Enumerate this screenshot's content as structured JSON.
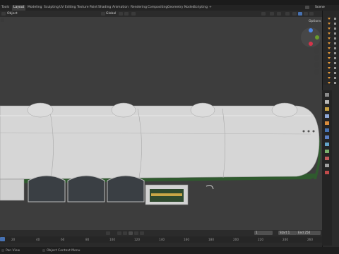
{
  "workspace_tabs": [
    "Tools",
    "Layout",
    "Modeling",
    "Sculpting",
    "UV Editing",
    "Texture Paint",
    "Shading",
    "Animation",
    "Rendering",
    "Compositing",
    "Geometry Nodes",
    "Scripting",
    "+"
  ],
  "active_tab": "Layout",
  "scene_label": "Scene",
  "viewport_header": {
    "mode": "Object",
    "orientation": "Global",
    "options_label": "Options"
  },
  "timeline": {
    "current_frame": "1",
    "start_label": "Start",
    "start_value": "1",
    "end_label": "End",
    "end_value": "250",
    "ruler": [
      "20",
      "40",
      "60",
      "80",
      "100",
      "120",
      "140",
      "160",
      "180",
      "200",
      "220",
      "240",
      "260"
    ]
  },
  "status_bar": {
    "left": "Pan View",
    "right": "Object Context Menu"
  },
  "colors": {
    "accent": "#4772b3",
    "background_viewport": "#3d3d3d",
    "model_body": "#d7d7d7",
    "model_trim": "#2f5a2e"
  },
  "icons": [
    "select-icon",
    "cursor-icon",
    "move-icon",
    "rotate-icon",
    "scale-icon",
    "zoom-icon",
    "hand-icon",
    "camera-icon",
    "grid-icon",
    "play-icon",
    "record-icon",
    "wrench-icon",
    "eye-icon",
    "triangle-filter-icon"
  ]
}
